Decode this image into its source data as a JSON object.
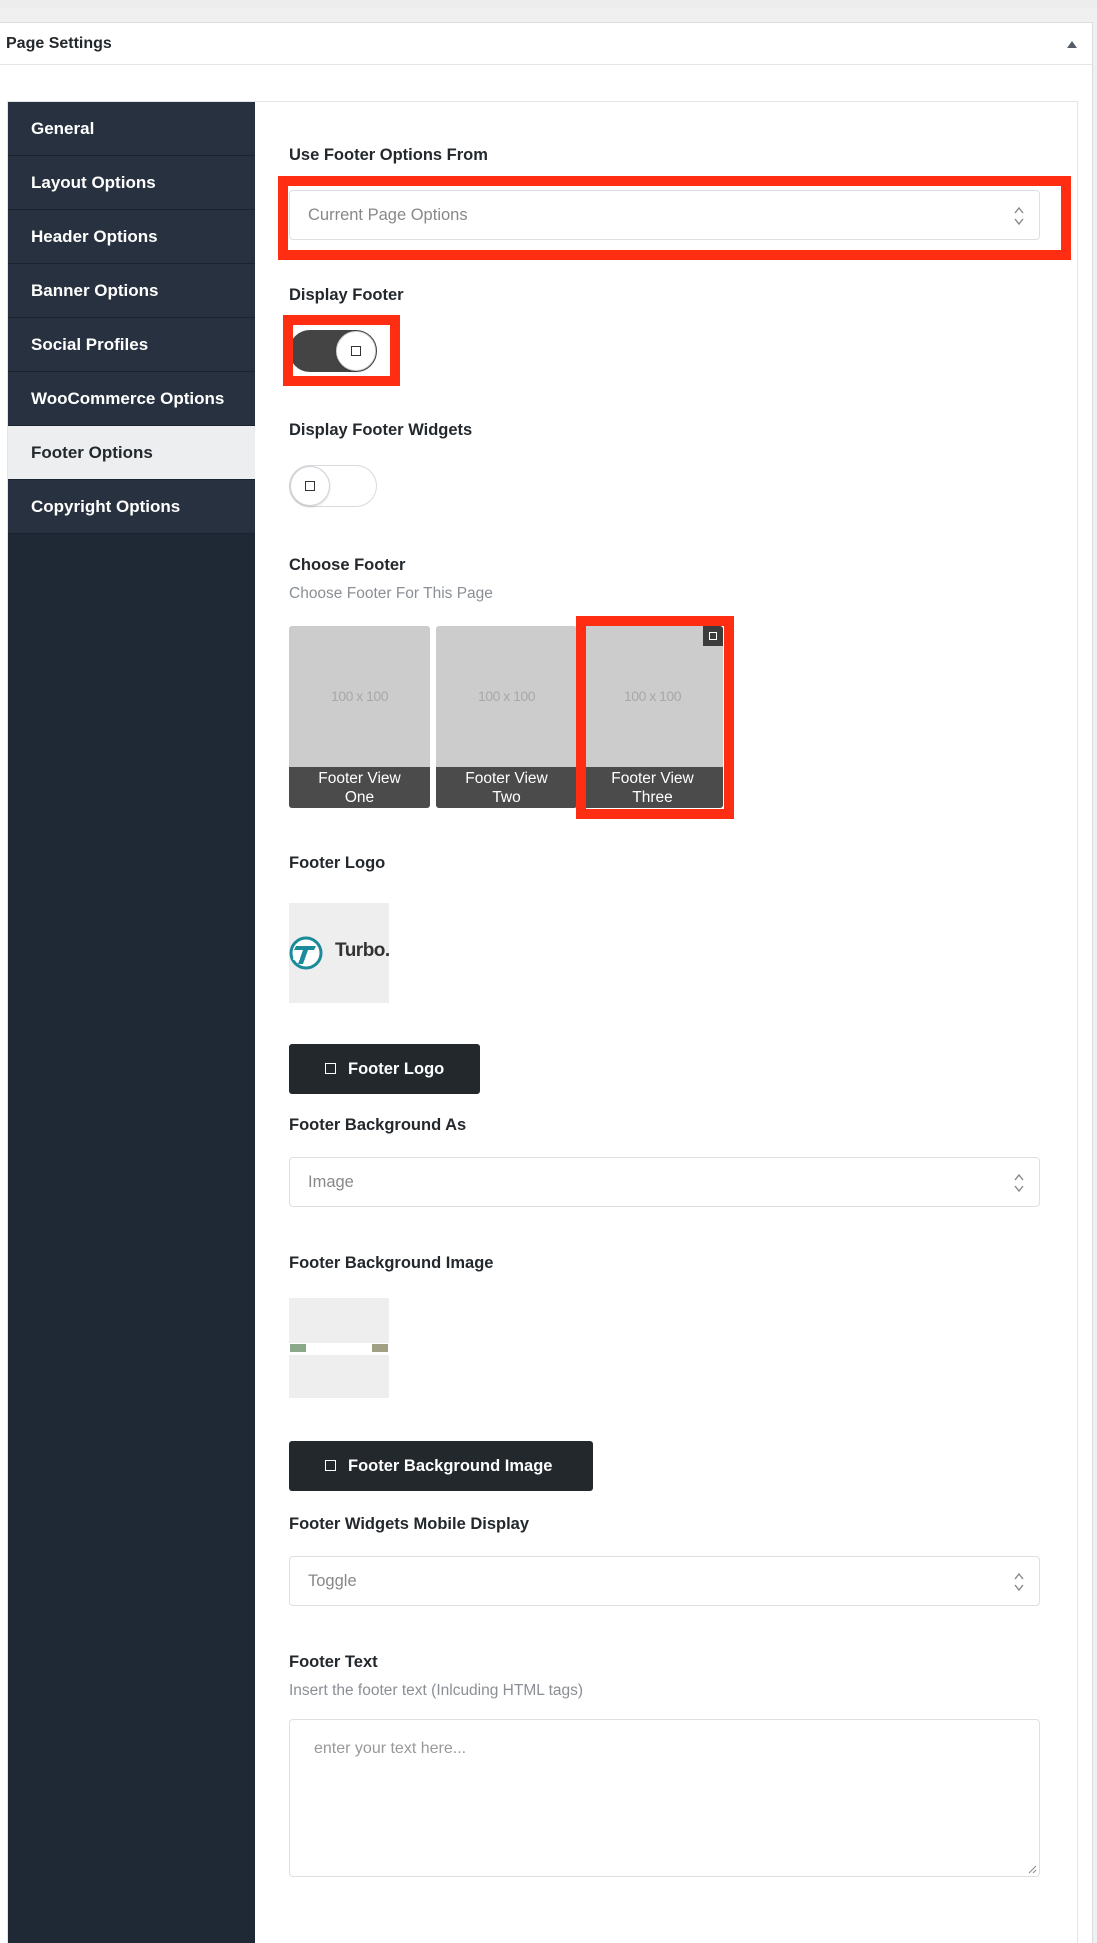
{
  "metabox": {
    "title": "Page Settings"
  },
  "sidebar": {
    "items": [
      {
        "label": "General",
        "active": false
      },
      {
        "label": "Layout Options",
        "active": false
      },
      {
        "label": "Header Options",
        "active": false
      },
      {
        "label": "Banner Options",
        "active": false
      },
      {
        "label": "Social Profiles",
        "active": false
      },
      {
        "label": "WooCommerce Options",
        "active": false
      },
      {
        "label": "Footer Options",
        "active": true
      },
      {
        "label": "Copyright Options",
        "active": false
      }
    ]
  },
  "fields": {
    "use_footer_from": {
      "label": "Use Footer Options From",
      "value": "Current Page Options"
    },
    "display_footer": {
      "label": "Display Footer",
      "state": "on"
    },
    "display_footer_widgets": {
      "label": "Display Footer Widgets",
      "state": "off"
    },
    "choose_footer": {
      "label": "Choose Footer",
      "description": "Choose Footer For This Page",
      "options": [
        {
          "placeholder": "100 x 100",
          "line1": "Footer View",
          "line2": "One",
          "selected": false
        },
        {
          "placeholder": "100 x 100",
          "line1": "Footer View",
          "line2": "Two",
          "selected": false
        },
        {
          "placeholder": "100 x 100",
          "line1": "Footer View",
          "line2": "Three",
          "selected": true
        }
      ]
    },
    "footer_logo": {
      "label": "Footer Logo",
      "logo_text": "Turbo.",
      "button_label": "Footer Logo"
    },
    "footer_background_as": {
      "label": "Footer Background As",
      "value": "Image"
    },
    "footer_background_image": {
      "label": "Footer Background Image",
      "button_label": "Footer Background Image"
    },
    "footer_widgets_mobile": {
      "label": "Footer Widgets Mobile Display",
      "value": "Toggle"
    },
    "footer_text": {
      "label": "Footer Text",
      "description": "Insert the footer text (Inlcuding HTML tags)",
      "placeholder": "enter your text here..."
    }
  },
  "colors": {
    "sidebar_bg": "#1f2936",
    "highlight": "#ff2d12",
    "button_bg": "#23282d"
  }
}
